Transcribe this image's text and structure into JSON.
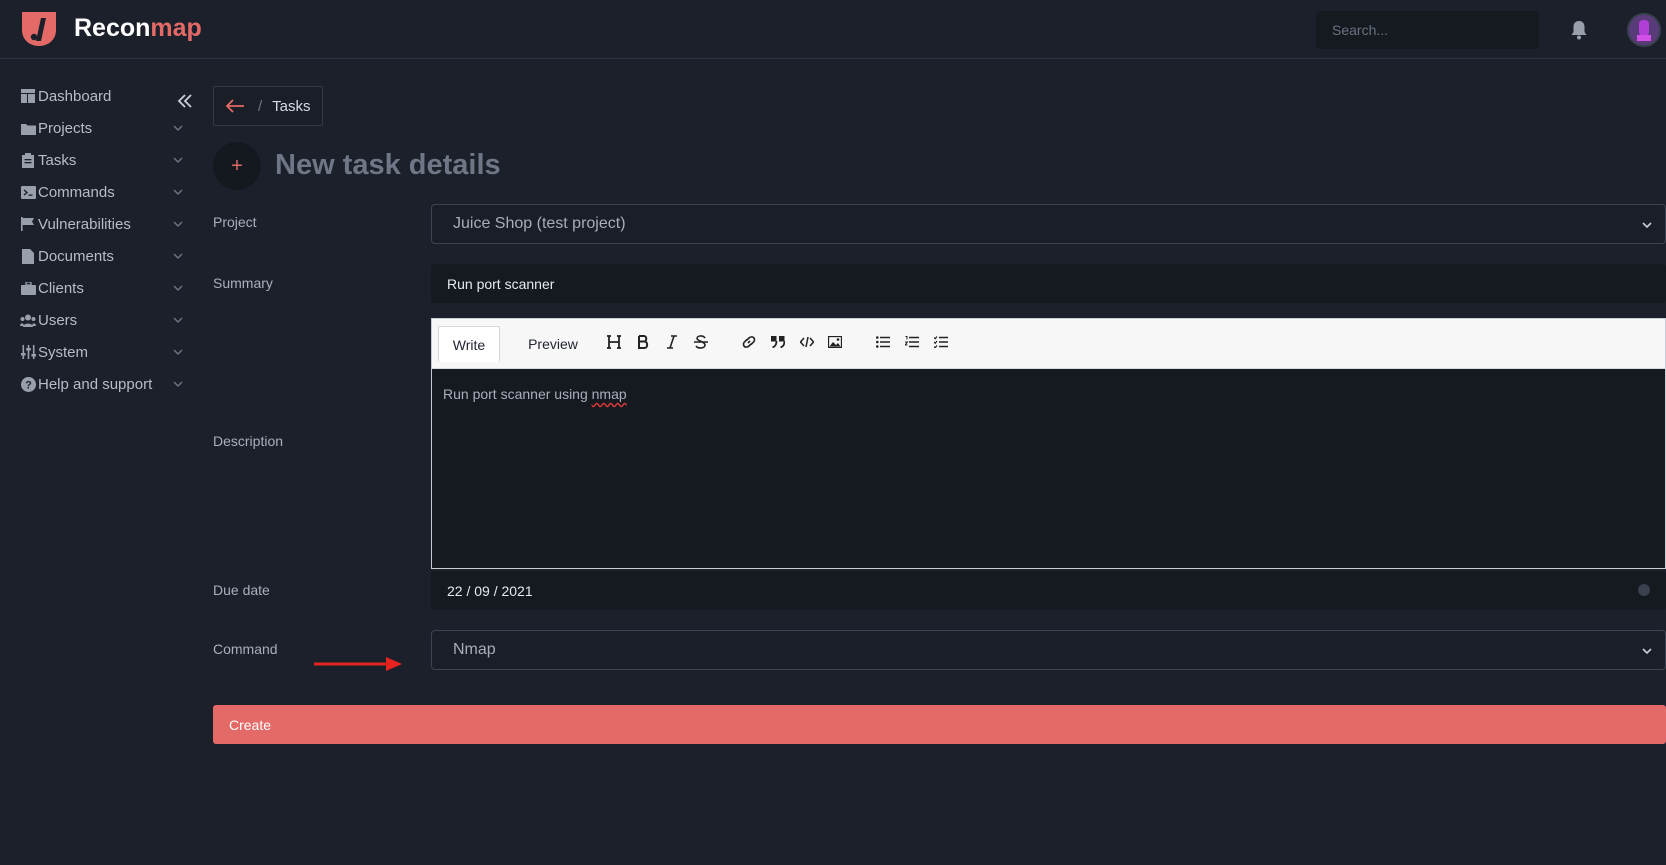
{
  "brand": {
    "name_part1": "Recon",
    "name_part2": "map",
    "accent_color": "#e36a67"
  },
  "header": {
    "search_placeholder": "Search..."
  },
  "sidebar": {
    "items": [
      {
        "label": "Dashboard",
        "icon": "dashboard-icon"
      },
      {
        "label": "Projects",
        "icon": "folder-icon"
      },
      {
        "label": "Tasks",
        "icon": "clipboard-icon"
      },
      {
        "label": "Commands",
        "icon": "terminal-icon"
      },
      {
        "label": "Vulnerabilities",
        "icon": "flag-icon"
      },
      {
        "label": "Documents",
        "icon": "document-icon"
      },
      {
        "label": "Clients",
        "icon": "briefcase-icon"
      },
      {
        "label": "Users",
        "icon": "users-icon"
      },
      {
        "label": "System",
        "icon": "sliders-icon"
      },
      {
        "label": "Help and support",
        "icon": "question-icon"
      }
    ]
  },
  "breadcrumb": {
    "separator": "/",
    "current": "Tasks"
  },
  "page": {
    "title_icon": "+",
    "title": "New task details"
  },
  "form": {
    "project_label": "Project",
    "project_value": "Juice Shop (test project)",
    "summary_label": "Summary",
    "summary_value": "Run port scanner",
    "description_label": "Description",
    "description_value_prefix": "Run port scanner using ",
    "description_value_misspelled": "nmap",
    "editor_tabs": {
      "write": "Write",
      "preview": "Preview"
    },
    "due_date_label": "Due date",
    "due_date_value": "22 / 09 / 2021",
    "command_label": "Command",
    "command_value": "Nmap",
    "submit_label": "Create"
  }
}
